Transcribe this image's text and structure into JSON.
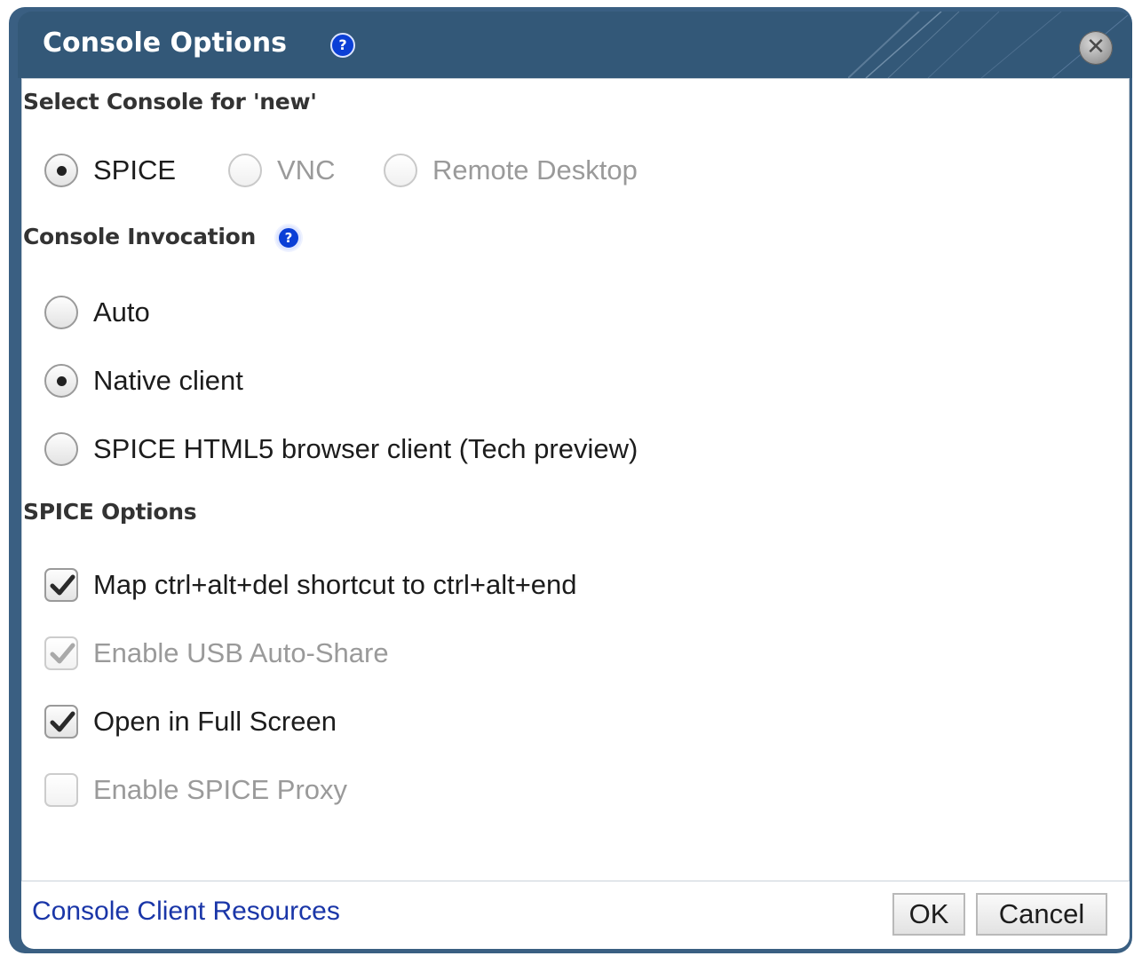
{
  "dialog": {
    "title": "Console Options",
    "help_glyph": "?",
    "close_glyph": "✕"
  },
  "select_console": {
    "heading": "Select Console for 'new'",
    "options": [
      {
        "label": "SPICE",
        "selected": true,
        "enabled": true
      },
      {
        "label": "VNC",
        "selected": false,
        "enabled": false
      },
      {
        "label": "Remote Desktop",
        "selected": false,
        "enabled": false
      }
    ]
  },
  "console_invocation": {
    "heading": "Console Invocation",
    "help_glyph": "?",
    "options": [
      {
        "label": "Auto",
        "selected": false
      },
      {
        "label": "Native client",
        "selected": true
      },
      {
        "label": "SPICE HTML5 browser client (Tech preview)",
        "selected": false
      }
    ]
  },
  "spice_options": {
    "heading": "SPICE Options",
    "checkboxes": [
      {
        "label": "Map ctrl+alt+del shortcut to ctrl+alt+end",
        "checked": true,
        "enabled": true
      },
      {
        "label": "Enable USB Auto-Share",
        "checked": true,
        "enabled": false
      },
      {
        "label": "Open in Full Screen",
        "checked": true,
        "enabled": true
      },
      {
        "label": "Enable SPICE Proxy",
        "checked": false,
        "enabled": false
      }
    ]
  },
  "footer": {
    "resources_link": "Console Client Resources",
    "ok_label": "OK",
    "cancel_label": "Cancel"
  },
  "colors": {
    "title_bar": "#335878",
    "help_icon": "#0b3fd6",
    "link": "#1a36a8"
  }
}
